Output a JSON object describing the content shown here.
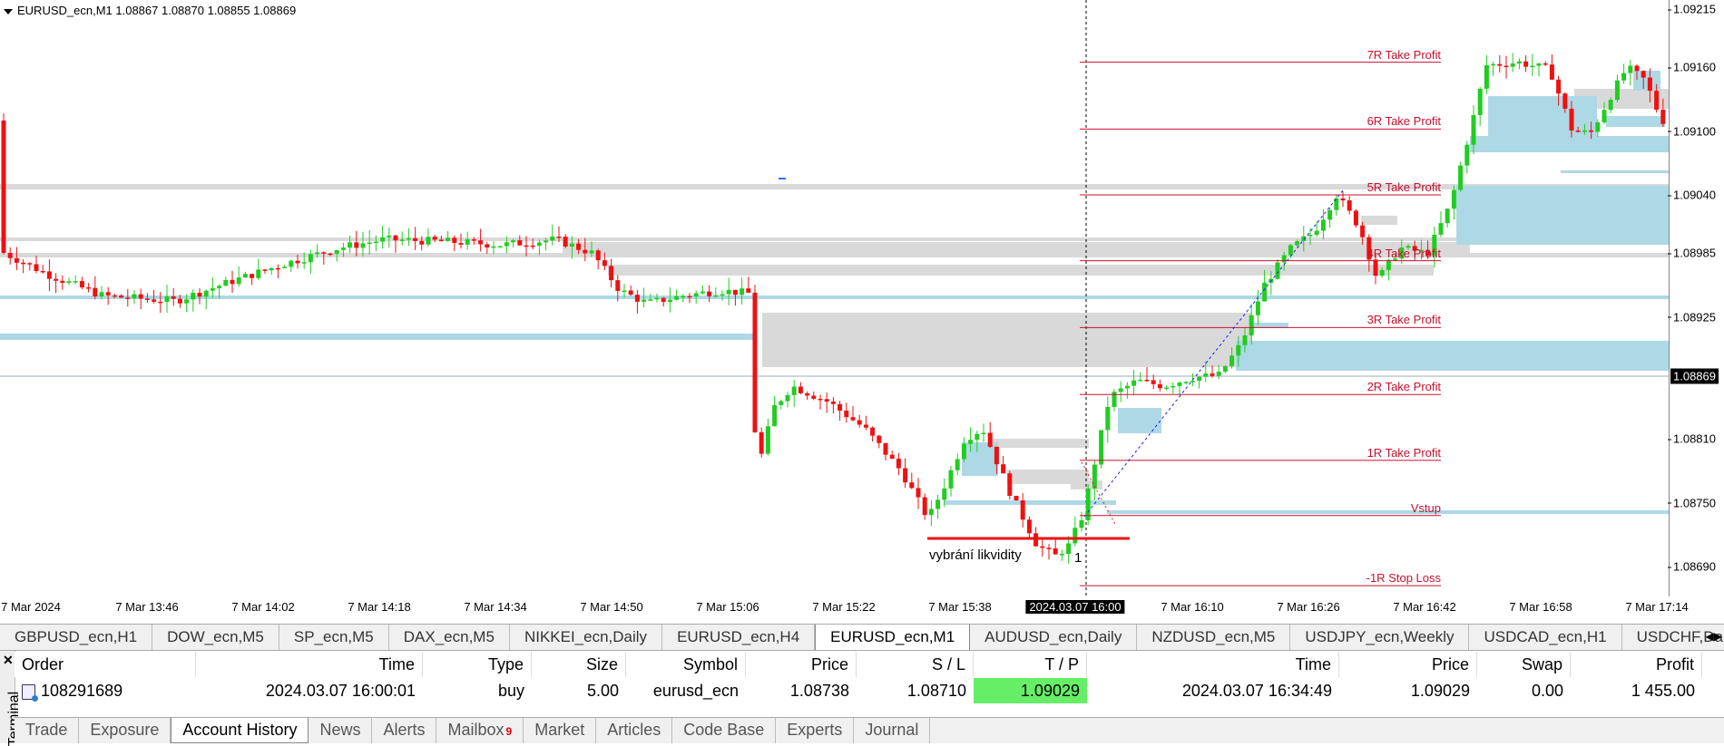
{
  "chart": {
    "symbol_info": "EURUSD_ecn,M1  1.08867 1.08870 1.08855 1.08869",
    "current_price": "1.08869",
    "price_ticks": [
      "1.09215",
      "1.09160",
      "1.09100",
      "1.09040",
      "1.08985",
      "1.08925",
      "1.08869",
      "1.08810",
      "1.08750",
      "1.08690"
    ],
    "time_ticks": [
      "7 Mar 2024",
      "7 Mar 13:46",
      "7 Mar 14:02",
      "7 Mar 14:18",
      "7 Mar 14:34",
      "7 Mar 14:50",
      "7 Mar 15:06",
      "7 Mar 15:22",
      "7 Mar 15:38",
      "2024.03.07 16:00",
      "7 Mar 16:10",
      "7 Mar 16:26",
      "7 Mar 16:42",
      "7 Mar 16:58",
      "7 Mar 17:14"
    ],
    "highlighted_time": "2024.03.07 16:00",
    "levels": [
      {
        "label": "7R Take Profit",
        "price": 1.09165
      },
      {
        "label": "6R Take Profit",
        "price": 1.09102
      },
      {
        "label": "5R Take Profit",
        "price": 1.0904
      },
      {
        "label": "4R Take Profit",
        "price": 1.08978
      },
      {
        "label": "3R Take Profit",
        "price": 1.08915
      },
      {
        "label": "2R Take Profit",
        "price": 1.08852
      },
      {
        "label": "1R Take Profit",
        "price": 1.0879
      },
      {
        "label": "Vstup",
        "price": 1.08738
      },
      {
        "label": "-1R Stop Loss",
        "price": 1.08672
      }
    ],
    "annotation_text": "vybrání likvidity",
    "annotation_number": "1",
    "colors": {
      "bull": "#22cc22",
      "bear": "#ee1111",
      "level": "#c8102e",
      "gray_zone": "#d9d9d9",
      "blue_zone": "#add8e6"
    }
  },
  "chart_tabs": [
    "GBPUSD_ecn,H1",
    "DOW_ecn,M5",
    "SP_ecn,M5",
    "DAX_ecn,M5",
    "NIKKEI_ecn,Daily",
    "EURUSD_ecn,H4",
    "EURUSD_ecn,M1",
    "AUDUSD_ecn,Daily",
    "NZDUSD_ecn,M5",
    "USDJPY_ecn,Weekly",
    "USDCAD_ecn,H1",
    "USDCHF,Daily"
  ],
  "active_chart_tab": "EURUSD_ecn,M1",
  "terminal": {
    "title": "Terminal",
    "columns": [
      "Order",
      "Time",
      "Type",
      "Size",
      "Symbol",
      "Price",
      "S / L",
      "T / P",
      "Time",
      "Price",
      "Swap",
      "Profit"
    ],
    "row": [
      "108291689",
      "2024.03.07 16:00:01",
      "buy",
      "5.00",
      "eurusd_ecn",
      "1.08738",
      "1.08710",
      "1.09029",
      "2024.03.07 16:34:49",
      "1.09029",
      "0.00",
      "1 455.00"
    ],
    "tabs": [
      "Trade",
      "Exposure",
      "Account History",
      "News",
      "Alerts",
      "Mailbox",
      "Market",
      "Articles",
      "Code Base",
      "Experts",
      "Journal"
    ],
    "active_tab": "Account History",
    "mailbox_badge": "9"
  }
}
